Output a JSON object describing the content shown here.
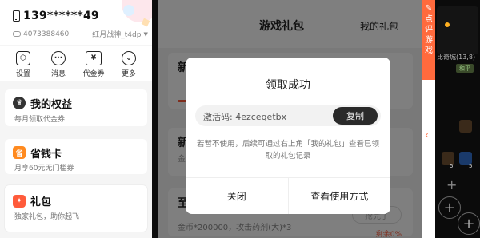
{
  "account": {
    "phone": "139******49",
    "uid": "4073388460",
    "role": "红月战神_t4dp"
  },
  "quick_actions": [
    {
      "label": "设置",
      "icon": "settings-icon",
      "glyph": "⬡"
    },
    {
      "label": "消息",
      "icon": "message-icon",
      "glyph": "···"
    },
    {
      "label": "代金券",
      "icon": "voucher-icon",
      "glyph": "¥"
    },
    {
      "label": "更多",
      "icon": "more-icon",
      "glyph": "⌄"
    }
  ],
  "cards": {
    "rights": {
      "title": "我的权益",
      "subtitle": "每月领取代金券"
    },
    "save": {
      "title": "省钱卡",
      "subtitle": "月享60元无门槛券",
      "icon_glyph": "省"
    },
    "gift": {
      "title": "礼包",
      "subtitle": "独家礼包，助你起飞"
    }
  },
  "gift_panel": {
    "title": "游戏礼包",
    "my_gift": "我的礼包",
    "items": [
      {
        "name": "新",
        "desc": ""
      },
      {
        "name": "新",
        "desc": "金"
      },
      {
        "name": "至",
        "desc": "金币*200000，攻击药剂(大)*3",
        "button": "抢完了",
        "remain": "剩余0%"
      }
    ]
  },
  "modal": {
    "title": "领取成功",
    "code_label": "激活码:",
    "code_value": "4ezceqetbx",
    "copy_button": "复制",
    "note": "若暂不使用，后续可通过右上角「我的礼包」查看已领取的礼包记录",
    "close_button": "关闭",
    "view_button": "查看使用方式"
  },
  "comment_tab": {
    "text": "点评游戏",
    "pen_glyph": "✎",
    "collapse_glyph": "‹"
  },
  "game": {
    "area_name": "比奇城(13,8)",
    "area_tag": "和平",
    "slot_counts": [
      "5",
      "5"
    ]
  },
  "colors": {
    "accent": "#ff6a3d",
    "copy_button_bg": "#2a2a2a"
  }
}
